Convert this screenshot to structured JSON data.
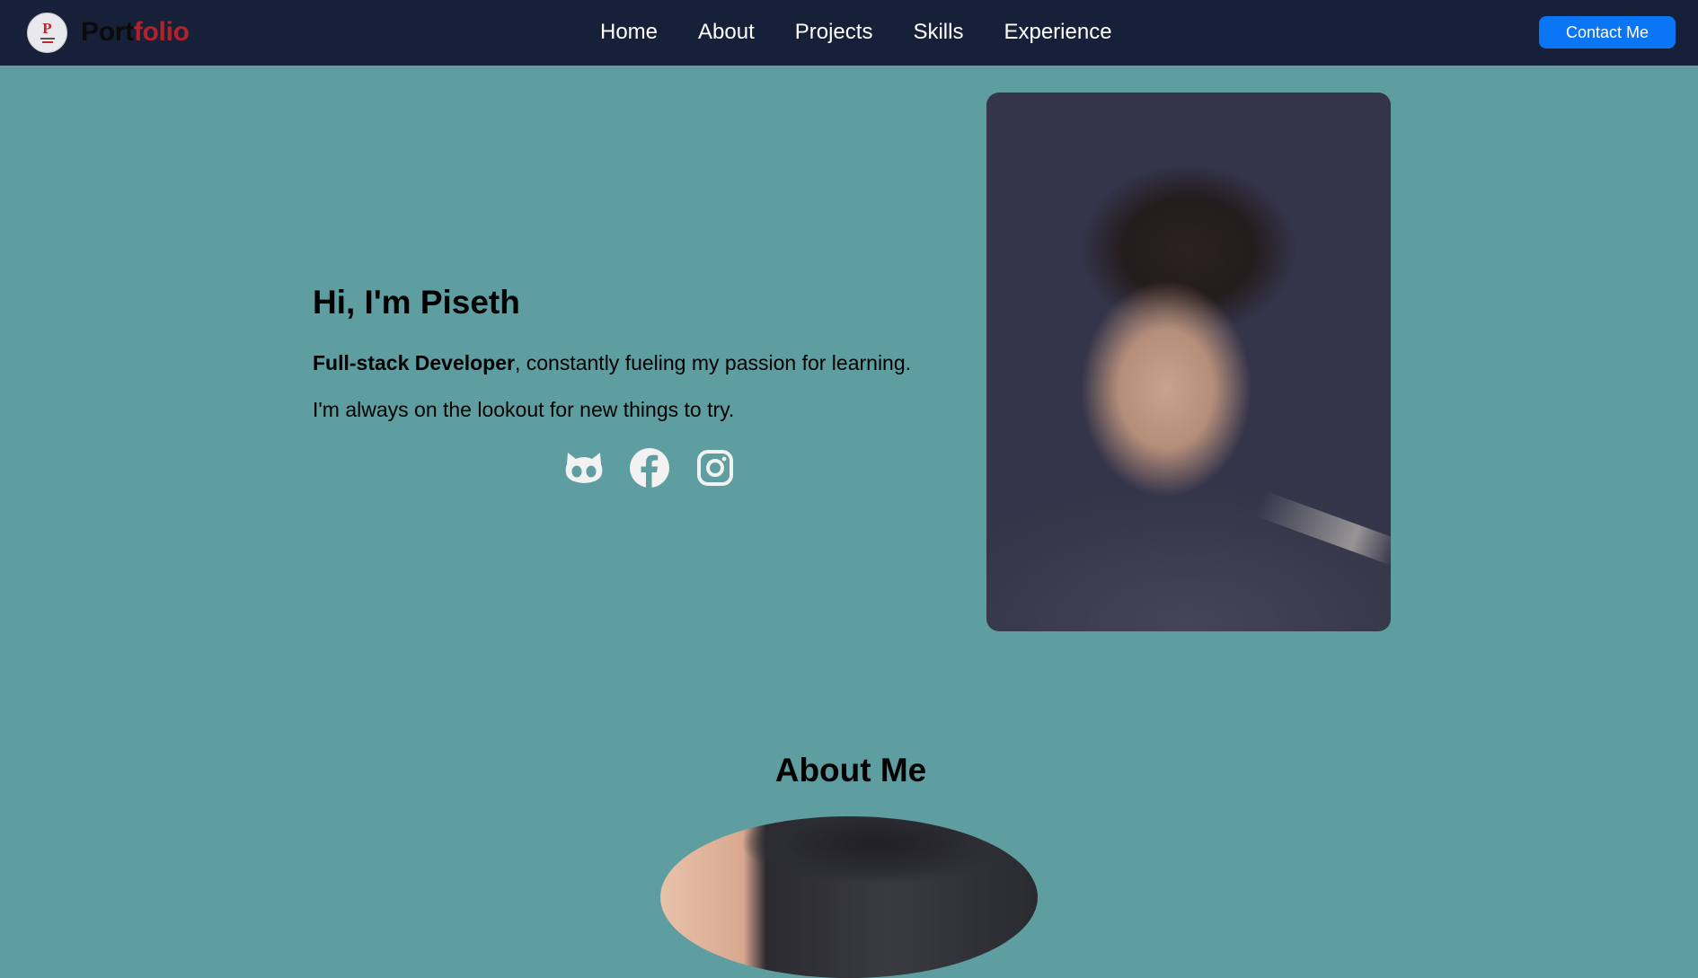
{
  "brand": {
    "name_part1": "Port",
    "name_part2": "folio",
    "logo_letter": "P",
    "logo_icon": "portfolio-logo-icon"
  },
  "nav": {
    "items": [
      {
        "label": "Home"
      },
      {
        "label": "About"
      },
      {
        "label": "Projects"
      },
      {
        "label": "Skills"
      },
      {
        "label": "Experience"
      }
    ],
    "contact_label": "Contact Me"
  },
  "hero": {
    "greeting": "Hi, I'm Piseth",
    "role_bold": "Full-stack Developer",
    "role_rest": ", constantly fueling my passion for learning.",
    "tagline": "I'm always on the lookout for new things to try.",
    "socials": [
      {
        "icon": "github-icon"
      },
      {
        "icon": "facebook-icon"
      },
      {
        "icon": "instagram-icon"
      }
    ]
  },
  "about": {
    "title": "About Me"
  },
  "colors": {
    "page_bg": "#5f9ea0",
    "navbar_bg": "#172039",
    "accent_red": "#b0232a",
    "button_blue": "#0a76f5",
    "icon_color": "#f2f2f2"
  }
}
